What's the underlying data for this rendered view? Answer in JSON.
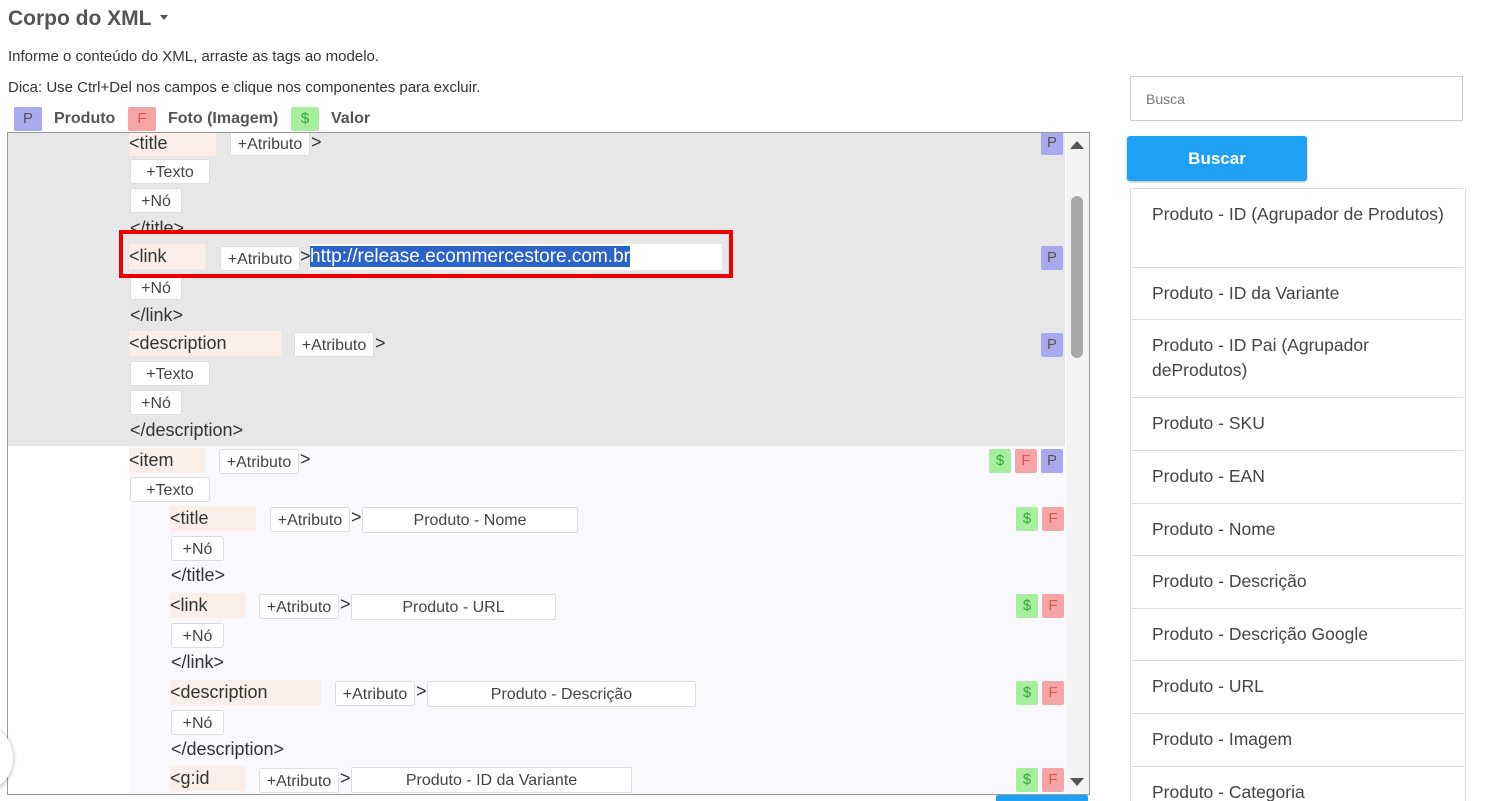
{
  "header": {
    "title": "Corpo do XML",
    "subtitle": "Informe o conteúdo do XML, arraste as tags ao modelo.",
    "tip": "Dica: Use Ctrl+Del nos campos e clique nos componentes para excluir."
  },
  "legend": [
    {
      "badge": "P",
      "label": "Produto"
    },
    {
      "badge": "F",
      "label": "Foto (Imagem)"
    },
    {
      "badge": "$",
      "label": "Valor"
    }
  ],
  "buttons": {
    "add_attribute": "+Atributo",
    "add_text": "+Texto",
    "add_node": "+Nó"
  },
  "badges": {
    "p": "P",
    "f": "F",
    "s": "$"
  },
  "editor": {
    "title_open": "<title",
    "title_close": "</title>",
    "link_open": "<link",
    "link_value": "http://release.ecommercestore.com.br",
    "link_close": "</link>",
    "description_open": "<description",
    "description_close": "</description>",
    "item_open": "<item",
    "gt": ">",
    "item_title_open": "<title",
    "item_title_value": "Produto - Nome",
    "item_title_close": "</title>",
    "item_link_open": "<link",
    "item_link_value": "Produto - URL",
    "item_link_close": "</link>",
    "item_desc_open": "<description",
    "item_desc_value": "Produto - Descrição",
    "item_desc_close": "</description>",
    "item_gid_open": "<g:id",
    "item_gid_value": "Produto - ID da Variante"
  },
  "search": {
    "placeholder": "Busca",
    "button": "Buscar"
  },
  "product_fields": [
    "Produto - ID (Agrupador de Produtos)",
    "Produto - ID da Variante",
    "Produto - ID Pai (Agrupador deProdutos)",
    "Produto - SKU",
    "Produto - EAN",
    "Produto - Nome",
    "Produto - Descrição",
    "Produto - Descrição Google",
    "Produto - URL",
    "Produto - Imagem",
    "Produto - Categoria"
  ],
  "colors": {
    "produto_badge": "#a9a9ee",
    "foto_badge": "#f5a5a5",
    "valor_badge": "#a7ee9f",
    "buscar_button": "#1ea1f5",
    "highlight_box": "#ee0000"
  }
}
